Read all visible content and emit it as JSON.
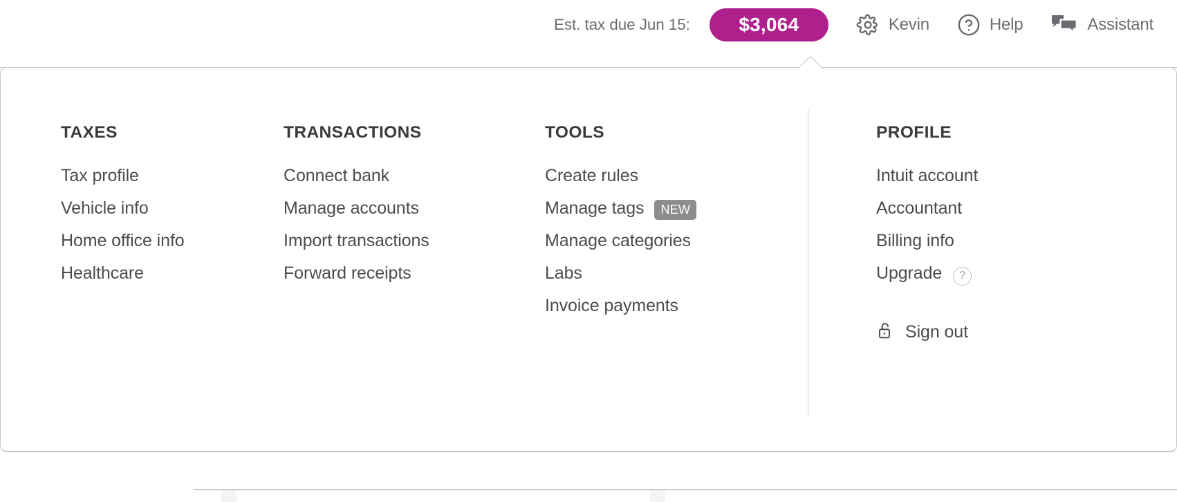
{
  "topbar": {
    "tax_due_label": "Est. tax due Jun 15:",
    "tax_amount": "$3,064",
    "tax_pill_color": "#b0208c",
    "items": [
      {
        "icon": "gear-icon",
        "label": "Kevin"
      },
      {
        "icon": "question-circle-icon",
        "label": "Help"
      },
      {
        "icon": "chat-bubbles-icon",
        "label": "Assistant"
      }
    ]
  },
  "menu": {
    "columns": [
      {
        "key": "taxes",
        "heading": "TAXES",
        "items": [
          {
            "label": "Tax profile"
          },
          {
            "label": "Vehicle info"
          },
          {
            "label": "Home office info"
          },
          {
            "label": "Healthcare"
          }
        ]
      },
      {
        "key": "transactions",
        "heading": "TRANSACTIONS",
        "items": [
          {
            "label": "Connect bank"
          },
          {
            "label": "Manage accounts"
          },
          {
            "label": "Import transactions"
          },
          {
            "label": "Forward receipts"
          }
        ]
      },
      {
        "key": "tools",
        "heading": "TOOLS",
        "items": [
          {
            "label": "Create rules"
          },
          {
            "label": "Manage tags",
            "badge": "NEW"
          },
          {
            "label": "Manage categories"
          },
          {
            "label": "Labs"
          },
          {
            "label": "Invoice payments"
          }
        ]
      },
      {
        "key": "profile",
        "heading": "PROFILE",
        "items": [
          {
            "label": "Intuit account"
          },
          {
            "label": "Accountant"
          },
          {
            "label": "Billing info"
          },
          {
            "label": "Upgrade",
            "help": "?"
          }
        ],
        "signout": {
          "icon": "unlock-icon",
          "label": "Sign out"
        }
      }
    ]
  },
  "colors": {
    "accent_magenta": "#b0208c",
    "badge_gray": "#8d8d8d",
    "text_dark": "#393a3d",
    "text_body": "#4b4c50",
    "text_muted": "#6b6c72",
    "panel_border": "#c5c5c5",
    "teal_accent": "#3aa7a0"
  }
}
